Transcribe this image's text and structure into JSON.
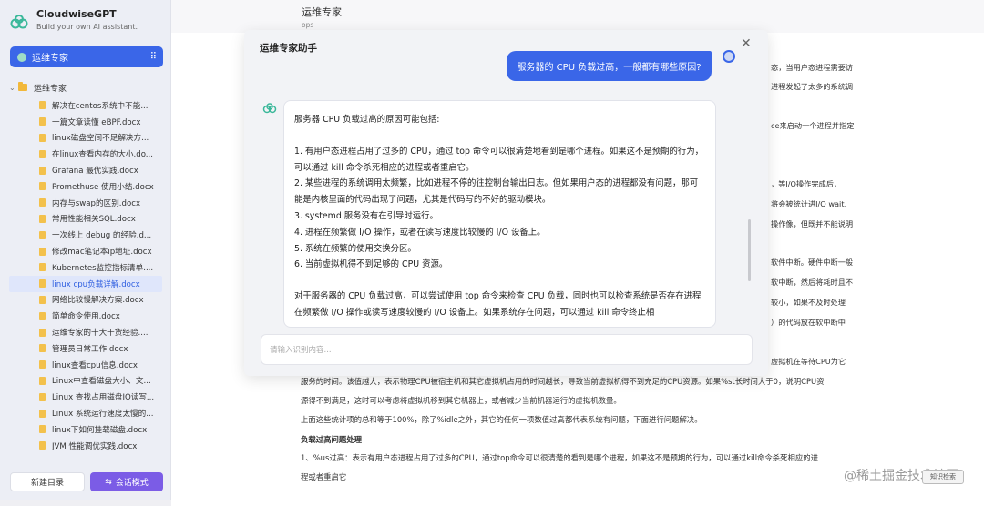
{
  "app": {
    "name": "CloudwiseGPT",
    "tagline": "Build your own AI assistant."
  },
  "sidebar": {
    "mode_label": "运维专家",
    "root_label": "运维专家",
    "items": [
      {
        "label": "解决在centos系统中不能...",
        "active": false
      },
      {
        "label": "一篇文章读懂 eBPF.docx",
        "active": false
      },
      {
        "label": "linux磁盘空间不足解决方...",
        "active": false
      },
      {
        "label": "在linux查看内存的大小.do...",
        "active": false
      },
      {
        "label": "Grafana 最优实践.docx",
        "active": false
      },
      {
        "label": "Promethuse 使用小结.docx",
        "active": false
      },
      {
        "label": "内存与swap的区别.docx",
        "active": false
      },
      {
        "label": "常用性能相关SQL.docx",
        "active": false
      },
      {
        "label": "一次线上 debug 的经验.d...",
        "active": false
      },
      {
        "label": "修改mac笔记本ip地址.docx",
        "active": false
      },
      {
        "label": "Kubernetes监控指标清单....",
        "active": false
      },
      {
        "label": "linux cpu负载详解.docx",
        "active": true
      },
      {
        "label": "网络比较慢解决方案.docx",
        "active": false
      },
      {
        "label": "简单命令使用.docx",
        "active": false
      },
      {
        "label": "运维专家的十大干货经验....",
        "active": false
      },
      {
        "label": "管理员日常工作.docx",
        "active": false
      },
      {
        "label": "linux查看cpu信息.docx",
        "active": false
      },
      {
        "label": "Linux中查看磁盘大小、文...",
        "active": false
      },
      {
        "label": "Linux 查找占用磁盘IO读写...",
        "active": false
      },
      {
        "label": "Linux 系统运行速度太慢的...",
        "active": false
      },
      {
        "label": "linux下如何挂载磁盘.docx",
        "active": false
      },
      {
        "label": "JVM 性能调优实践.docx",
        "active": false
      }
    ],
    "new_dir": "新建目录",
    "chat_mode": "会话模式"
  },
  "doc": {
    "title": "运维专家",
    "subtitle": "ops",
    "right_fragments": [
      "态，当用户态进程需要访",
      "进程发起了太多的系统调",
      "ce来启动一个进程并指定",
      "，等I/O操作完成后，",
      "将会被统计进I/O wait,",
      "操作像，但既并不能说明",
      "软件中断。硬件中断一般",
      "软中断，然后将耗时且不",
      "较小，如果不及时处理",
      "）的代码放在软中断中",
      "虚拟机在等待CPU为它"
    ],
    "lines": [
      "服务的时间。该值越大，表示物理CPU被宿主机和其它虚拟机占用的时间越长，导致当前虚拟机得不到充足的CPU资源。如果%st长时间大于0，说明CPU资",
      "源得不到满足，这时可以考虑将虚拟机移到其它机器上，或者减少当前机器运行的虚拟机数量。",
      "上面这些统计项的总和等于100%，除了%idle之外，其它的任何一项数值过高都代表系统有问题，下面进行问题解决。",
      "负载过高问题处理",
      "1、%us过高：表示有用户态进程占用了过多的CPU，通过top命令可以很清楚的看到是哪个进程，如果这不是预期的行为，可以通过kill命令杀死相应的进",
      "程或者重启它"
    ]
  },
  "watermark": "@稀土掘金技术社区",
  "watermark_button": "知识检索",
  "modal": {
    "title": "运维专家助手",
    "user_message": "服务器的 CPU 负载过高，一般都有哪些原因?",
    "bot_paragraphs": [
      "服务器 CPU 负载过高的原因可能包括:",
      "1. 有用户态进程占用了过多的 CPU，通过 top 命令可以很清楚地看到是哪个进程。如果这不是预期的行为，可以通过 kill 命令杀死相应的进程或者重启它。\n2. 某些进程的系统调用太频繁，比如进程不停的往控制台输出日志。但如果用户态的进程都没有问题，那可能是内核里面的代码出现了问题，尤其是代码写的不好的驱动模块。\n3. systemd 服务没有在引导时运行。\n4. 进程在频繁做 I/O 操作，或者在读写速度比较慢的 I/O 设备上。\n5. 系统在频繁的使用交换分区。\n6. 当前虚拟机得不到足够的 CPU 资源。",
      "对于服务器的 CPU 负载过高，可以尝试使用 top 命令来检查 CPU 负载，同时也可以检查系统是否存在进程在频繁做 I/O 操作或读写速度较慢的 I/O 设备上。如果系统存在问题，可以通过 kill 命令终止相"
    ],
    "input_placeholder": "请输入识别内容..."
  }
}
